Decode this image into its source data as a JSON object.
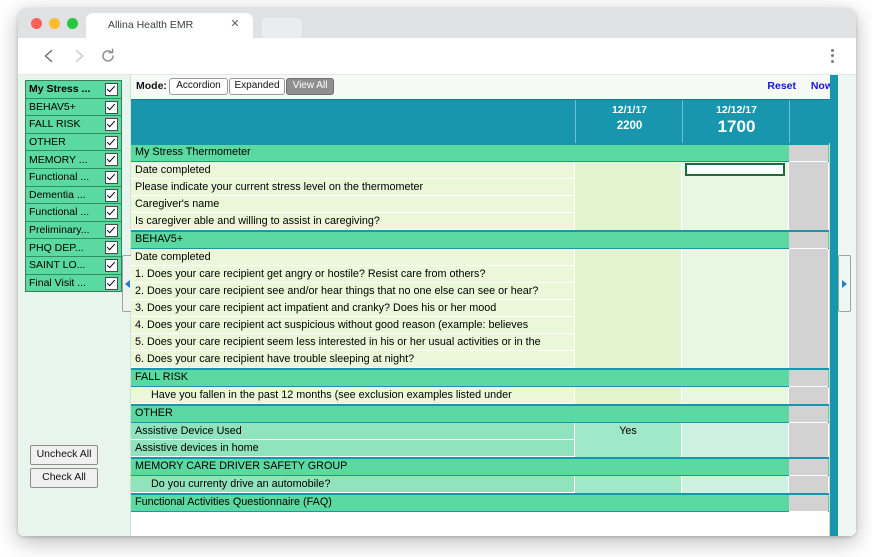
{
  "browser": {
    "tab_title": "Allina Health EMR",
    "tab_close_icon": "close-icon",
    "back_icon": "back-arrow-icon",
    "forward_icon": "forward-arrow-icon",
    "reload_icon": "reload-icon",
    "menu_icon": "kebab-menu-icon"
  },
  "sidebar": {
    "items": [
      {
        "label": "My Stress ...",
        "checked": true,
        "bold": true
      },
      {
        "label": "BEHAV5+",
        "checked": true,
        "bold": false
      },
      {
        "label": "FALL RISK",
        "checked": true,
        "bold": false
      },
      {
        "label": "OTHER",
        "checked": true,
        "bold": false
      },
      {
        "label": "MEMORY ...",
        "checked": true,
        "bold": false
      },
      {
        "label": "Functional ...",
        "checked": true,
        "bold": false
      },
      {
        "label": "Dementia ...",
        "checked": true,
        "bold": false
      },
      {
        "label": "Functional ...",
        "checked": true,
        "bold": false
      },
      {
        "label": "Preliminary...",
        "checked": true,
        "bold": false
      },
      {
        "label": "PHQ DEP...",
        "checked": true,
        "bold": false
      },
      {
        "label": "SAINT LO...",
        "checked": true,
        "bold": false
      },
      {
        "label": "Final Visit ...",
        "checked": true,
        "bold": false
      }
    ],
    "uncheck_all_label": "Uncheck All",
    "check_all_label": "Check All",
    "collapse_handle_icon": "chevron-left-icon"
  },
  "toolbar": {
    "mode_label": "Mode:",
    "accordion_label": "Accordion",
    "expanded_label": "Expanded",
    "view_all_label": "View All",
    "reset_label": "Reset",
    "now_label": "Now"
  },
  "columns": [
    {
      "date": "12/1/17",
      "time": "2200"
    },
    {
      "date": "12/12/17",
      "time": "1700"
    },
    {
      "date": "",
      "time": ""
    }
  ],
  "rows": [
    {
      "type": "section",
      "label": "My Stress Thermometer"
    },
    {
      "type": "pale",
      "label": "Date completed",
      "v1": "",
      "v2": "",
      "input_col": 2
    },
    {
      "type": "pale",
      "label": "Please indicate your current stress level on the thermometer",
      "v1": "",
      "v2": ""
    },
    {
      "type": "pale",
      "label": "Caregiver's name",
      "v1": "",
      "v2": ""
    },
    {
      "type": "pale",
      "label": "Is caregiver able and willing to assist in caregiving?",
      "v1": "",
      "v2": ""
    },
    {
      "type": "section",
      "label": "BEHAV5+"
    },
    {
      "type": "pale",
      "label": "Date completed",
      "v1": "",
      "v2": ""
    },
    {
      "type": "pale",
      "label": "1. Does your care recipient get angry or hostile? Resist care from others?",
      "v1": "",
      "v2": ""
    },
    {
      "type": "pale",
      "label": "2. Does your care recipient see and/or hear things that no one else can see or hear?",
      "v1": "",
      "v2": ""
    },
    {
      "type": "pale",
      "label": "3. Does your care recipient act impatient and cranky? Does his or her mood",
      "v1": "",
      "v2": ""
    },
    {
      "type": "pale",
      "label": "4. Does your care recipient act suspicious without good reason (example: believes",
      "v1": "",
      "v2": ""
    },
    {
      "type": "pale",
      "label": "5. Does your care recipient seem less interested in his or her usual activities or in the",
      "v1": "",
      "v2": ""
    },
    {
      "type": "pale",
      "label": "6. Does your care recipient have trouble sleeping at night?",
      "v1": "",
      "v2": ""
    },
    {
      "type": "section",
      "label": "FALL RISK"
    },
    {
      "type": "pale",
      "icon": "flowsheet-graph-icon",
      "label": "Have you fallen in the past 12 months (see exclusion examples listed under",
      "v1": "",
      "v2": ""
    },
    {
      "type": "section",
      "label": "OTHER"
    },
    {
      "type": "mint",
      "label": "Assistive Device Used",
      "v1": "Yes",
      "v2": ""
    },
    {
      "type": "mint",
      "label": "Assistive devices in home",
      "v1": "",
      "v2": ""
    },
    {
      "type": "section",
      "label": "MEMORY CARE DRIVER SAFETY GROUP"
    },
    {
      "type": "mint",
      "icon": "flowsheet-graph-icon",
      "label": "Do you currenty drive an automobile?",
      "v1": "",
      "v2": ""
    },
    {
      "type": "section",
      "label": "Functional Activities Questionnaire (FAQ)"
    }
  ],
  "scrollbar": {
    "up_icon": "scroll-up-arrow-icon",
    "down_icon": "scroll-down-arrow-icon"
  },
  "right_panel": {
    "collapse_handle_icon": "chevron-right-icon"
  },
  "colors": {
    "header_teal": "#1896ae",
    "section_green": "#5ad9a0",
    "pale_row": "#eaf7d8",
    "mint_row": "#8fe3bd",
    "link_blue": "#1414dc"
  }
}
